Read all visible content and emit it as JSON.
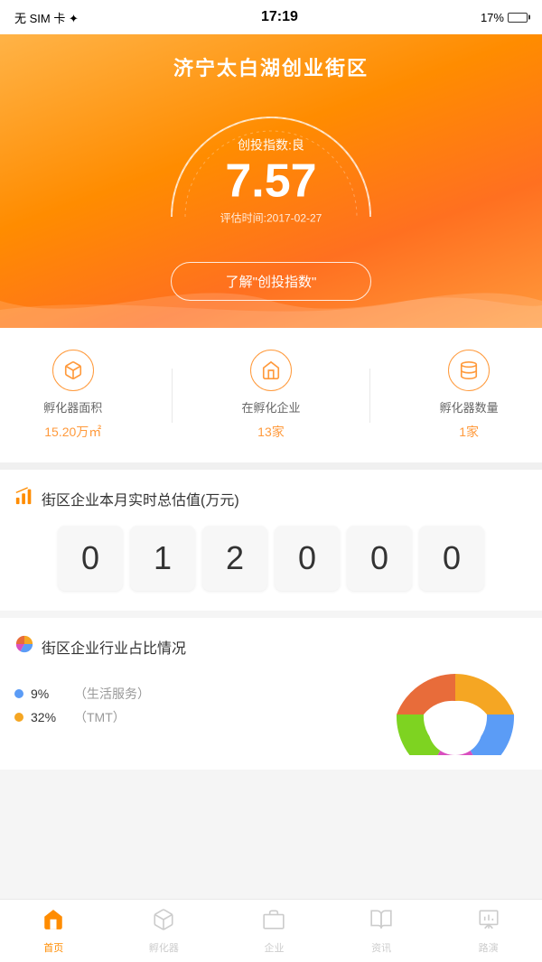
{
  "statusBar": {
    "left": "无 SIM 卡 ✦",
    "time": "17:19",
    "battery": "17%"
  },
  "hero": {
    "title": "济宁太白湖创业街区",
    "indexLabel": "创投指数:良",
    "indexValue": "7.57",
    "dateLabel": "评估时间:2017-02-27",
    "knowButton": "了解\"创投指数\""
  },
  "stats": [
    {
      "id": "area",
      "icon": "box",
      "name": "孵化器面积",
      "value": "15.20万㎡"
    },
    {
      "id": "company",
      "icon": "home",
      "name": "在孵化企业",
      "value": "13家"
    },
    {
      "id": "count",
      "icon": "db",
      "name": "孵化器数量",
      "value": "1家"
    }
  ],
  "valuation": {
    "sectionTitle": "街区企业本月实时总估值(万元)",
    "digits": [
      "0",
      "1",
      "2",
      "0",
      "0",
      "0"
    ]
  },
  "industry": {
    "sectionTitle": "街区企业行业占比情况",
    "legend": [
      {
        "color": "#5b9cf6",
        "percent": "9%",
        "name": "（生活服务）"
      },
      {
        "color": "#f5a623",
        "percent": "32%",
        "name": "（TMT）"
      }
    ],
    "chartColors": [
      "#f5a623",
      "#5b9cf6",
      "#d94fbf",
      "#7ed321",
      "#e86c3a"
    ]
  },
  "nav": [
    {
      "id": "home",
      "icon": "🏠",
      "label": "首页",
      "active": true
    },
    {
      "id": "incubator",
      "icon": "📦",
      "label": "孵化器",
      "active": false
    },
    {
      "id": "enterprise",
      "icon": "🏢",
      "label": "企业",
      "active": false
    },
    {
      "id": "news",
      "icon": "📰",
      "label": "资讯",
      "active": false
    },
    {
      "id": "roadshow",
      "icon": "📊",
      "label": "路演",
      "active": false
    }
  ]
}
